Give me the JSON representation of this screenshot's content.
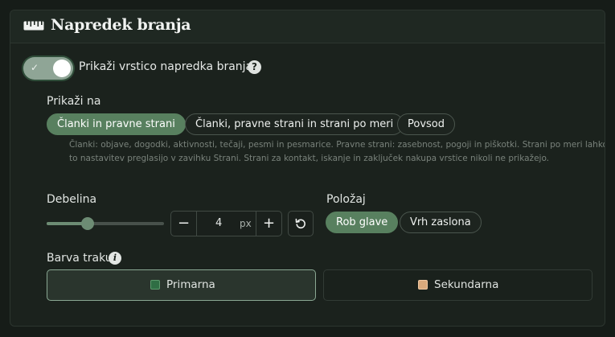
{
  "panel": {
    "title": "Napredek branja",
    "icon": "ruler-icon"
  },
  "toggle": {
    "label": "Prikaži vrstico napredka branja",
    "checked": true,
    "help_icon": "question-icon"
  },
  "show_on": {
    "label": "Prikaži na",
    "options": [
      {
        "label": "Članki in pravne strani",
        "active": true
      },
      {
        "label": "Članki, pravne strani in strani po meri",
        "active": false
      },
      {
        "label": "Povsod",
        "active": false
      }
    ],
    "hint": "Članki: objave, dogodki, aktivnosti, tečaji, pesmi in pesmarice. Pravne strani: zasebnost, pogoji in piškotki. Strani po meri lahko to nastavitev preglasijo v zavihku Strani. Strani za kontakt, iskanje in zaključek nakupa vrstice nikoli ne prikažejo."
  },
  "thickness": {
    "label": "Debelina",
    "value": "4",
    "unit": "px",
    "slider_fraction": 0.35,
    "minus": "−",
    "plus": "+"
  },
  "position": {
    "label": "Položaj",
    "options": [
      {
        "label": "Rob glave",
        "active": true
      },
      {
        "label": "Vrh zaslona",
        "active": false
      }
    ]
  },
  "bar_color": {
    "label": "Barva traku",
    "options": [
      {
        "label": "Primarna",
        "color": "#2f6e44",
        "selected": true
      },
      {
        "label": "Sekundarna",
        "color": "#d9a97c",
        "selected": false
      }
    ]
  }
}
